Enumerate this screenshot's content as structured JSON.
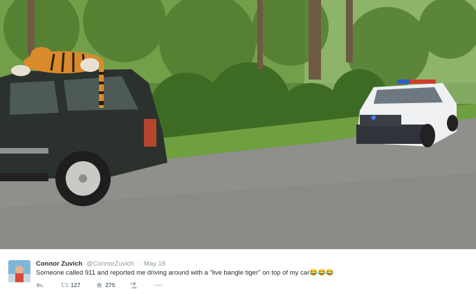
{
  "tweet": {
    "display_name": "Connor Zuvich",
    "handle": "@ConnorZuvich",
    "separator": "·",
    "date": "May 18",
    "text": "Someone called 911 and reported me driving around with a \"live bangle tiger\" on top of my car😂😂😂",
    "retweet_count": "127",
    "favorite_count": "275",
    "more_label": "•••"
  },
  "icons": [
    "reply-icon",
    "retweet-icon",
    "star-icon",
    "follow-icon",
    "more-icon"
  ],
  "colors": {
    "text": "#292f33",
    "muted": "#8899a6",
    "icon": "#aab8c2"
  }
}
